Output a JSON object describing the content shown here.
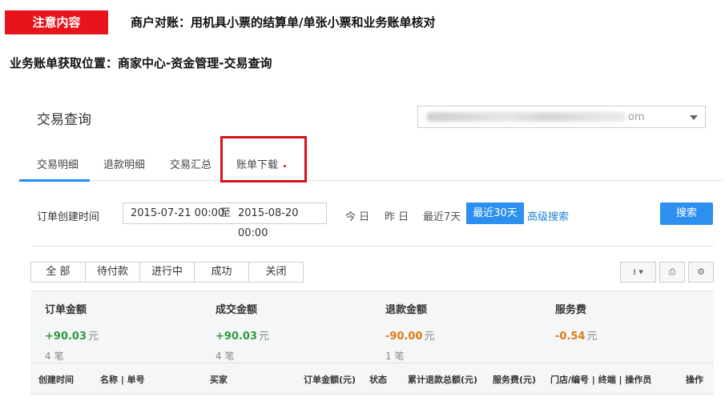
{
  "annotation": {
    "tag": "注意内容",
    "heading": "商户对账：用机具小票的结算单/单张小票和业务账单核对",
    "location": "业务账单获取位置：商家中心-资金管理-交易查询"
  },
  "page": {
    "title": "交易查询",
    "account_select": {
      "visible_suffix": "om"
    }
  },
  "tabs": [
    {
      "label": "交易明细",
      "active": true
    },
    {
      "label": "退款明细"
    },
    {
      "label": "交易汇总"
    },
    {
      "label": "账单下载",
      "highlighted": true
    }
  ],
  "filter": {
    "label": "订单创建时间",
    "start": "2015-07-21 00:00",
    "to": "至",
    "end": "2015-08-20 00:00",
    "quick": [
      "今 日",
      "昨 日",
      "最近7天",
      "最近30天"
    ],
    "active_quick": "最近30天",
    "advanced": "高级搜索",
    "search_button": "搜索"
  },
  "status_filters": [
    "全 部",
    "待付款",
    "进行中",
    "成功",
    "关闭"
  ],
  "toolbar_icons": [
    "download-icon",
    "print-icon",
    "settings-icon"
  ],
  "summary": [
    {
      "label": "订单金额",
      "amount": "+90.03",
      "unit": "元",
      "count": "4 笔",
      "color": "#2e9a3c"
    },
    {
      "label": "成交金额",
      "amount": "+90.03",
      "unit": "元",
      "count": "4 笔",
      "color": "#2e9a3c"
    },
    {
      "label": "退款金额",
      "amount": "-90.00",
      "unit": "元",
      "count": "1 笔",
      "color": "#e07a12"
    },
    {
      "label": "服务费",
      "amount": "-0.54",
      "unit": "元",
      "count": "",
      "color": "#e07a12"
    }
  ],
  "table_headers": [
    "创建时间",
    "名称 | 单号",
    "买家",
    "订单金额(元)",
    "状态",
    "累计退款总额(元)",
    "服务费(元)",
    "门店/编号 | 终端 | 操作员",
    "操作"
  ],
  "colors": {
    "accent": "#2d8ff0",
    "annotation_red": "#e8141b",
    "positive": "#2e9a3c",
    "negative": "#e07a12"
  }
}
